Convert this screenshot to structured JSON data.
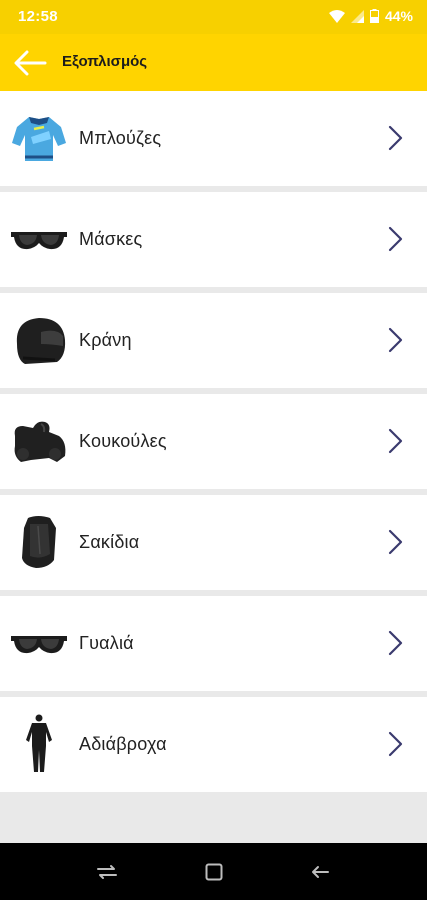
{
  "status_bar": {
    "time": "12:58",
    "battery": "44%"
  },
  "app_bar": {
    "title": "Εξοπλισμός"
  },
  "items": [
    {
      "label": "Μπλούζες",
      "icon": "jersey-icon"
    },
    {
      "label": "Μάσκες",
      "icon": "goggles-icon"
    },
    {
      "label": "Κράνη",
      "icon": "helmet-icon"
    },
    {
      "label": "Κουκούλες",
      "icon": "motorcycle-cover-icon"
    },
    {
      "label": "Σακίδια",
      "icon": "backpack-icon"
    },
    {
      "label": "Γυαλιά",
      "icon": "goggles-icon"
    },
    {
      "label": "Αδιάβροχα",
      "icon": "rain-suit-icon"
    }
  ],
  "colors": {
    "accent": "#ffd400",
    "chevron": "#3a3a6e",
    "background": "#e9e9e9"
  }
}
